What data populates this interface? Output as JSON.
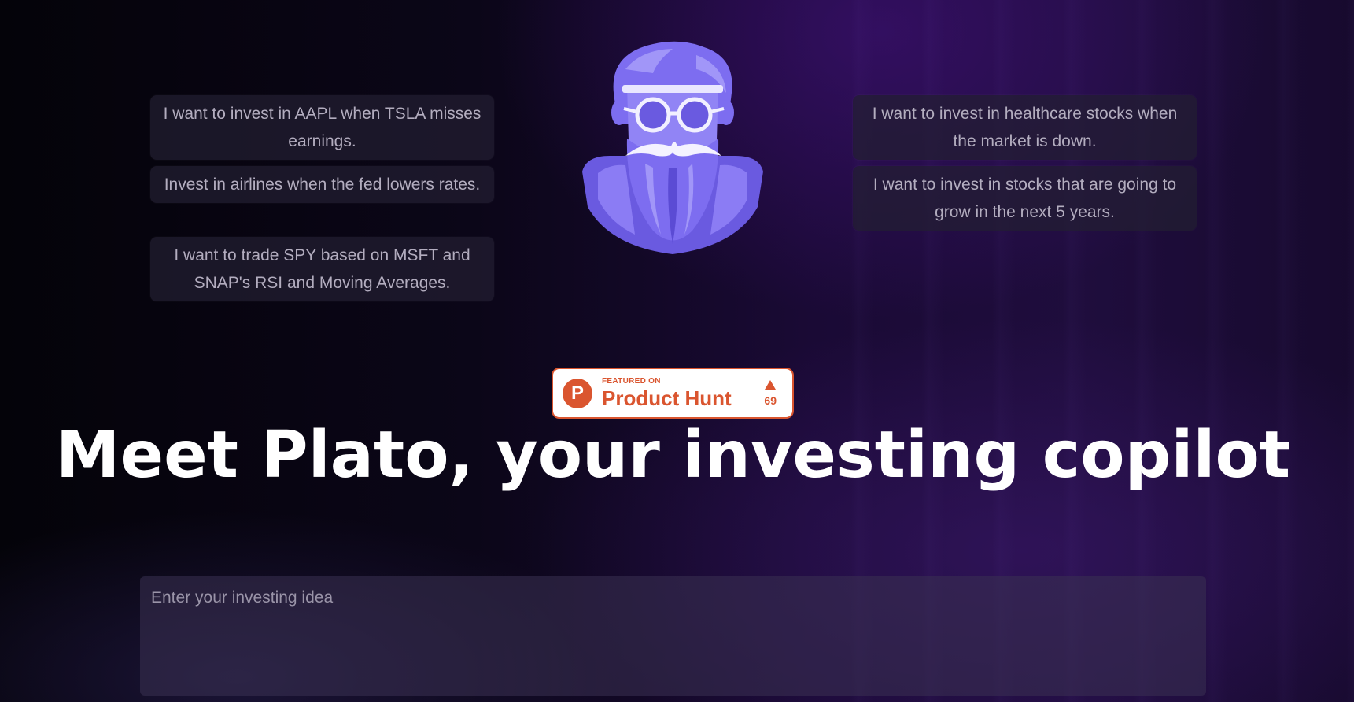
{
  "prompts_left": [
    "I want to invest in AAPL when TSLA misses earnings.",
    "Invest in airlines when the fed lowers rates.",
    "I want to trade SPY based on MSFT and SNAP's RSI and Moving Averages."
  ],
  "prompts_right": [
    "I want to invest in healthcare stocks when the market is down.",
    "I want to invest in stocks that are going to grow in the next 5 years."
  ],
  "mascot": {
    "icon": "plato-bust-icon"
  },
  "product_hunt": {
    "featured_label": "FEATURED ON",
    "name": "Product Hunt",
    "logo_letter": "P",
    "votes": "69",
    "brand_color": "#da552f"
  },
  "headline": "Meet Plato, your investing copilot",
  "idea_input": {
    "placeholder": "Enter your investing idea",
    "value": ""
  },
  "colors": {
    "accent_purple": "#7b6cf0",
    "bubble_text": "#b3adbf"
  }
}
